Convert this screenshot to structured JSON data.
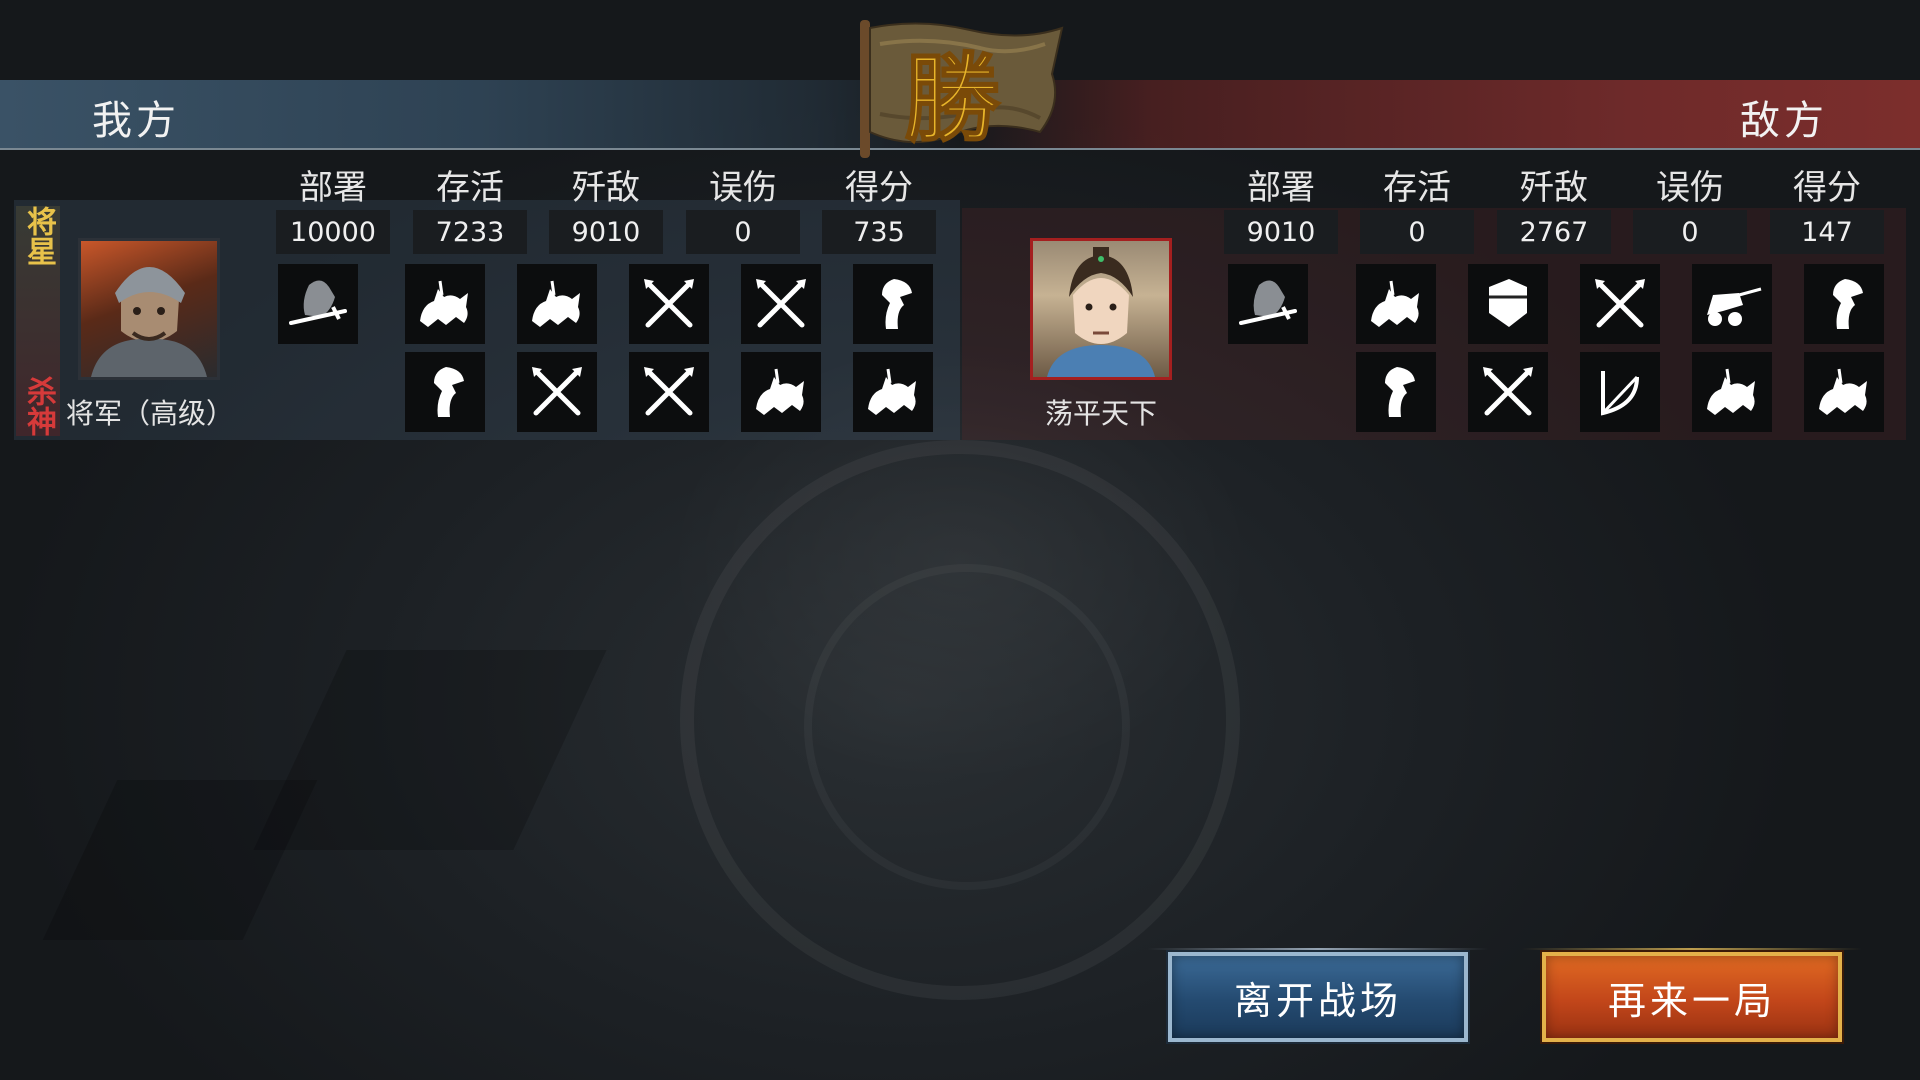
{
  "header": {
    "left_title": "我方",
    "right_title": "敌方",
    "result_text": "勝"
  },
  "columns": [
    "部署",
    "存活",
    "歼敌",
    "误伤",
    "得分"
  ],
  "player": {
    "rank_label": "将军（高级）",
    "badge_top": "将星",
    "badge_bottom": "杀神",
    "stats": [
      "10000",
      "7233",
      "9010",
      "0",
      "735"
    ],
    "units_row1": [
      "general-sword-icon",
      "cavalry-icon",
      "cavalry-icon",
      "crossed-spears-icon",
      "crossed-spears-icon",
      "axe-infantry-icon"
    ],
    "units_row2": [
      "axe-infantry-icon",
      "crossed-spears-icon",
      "crossed-spears-icon",
      "cavalry-icon",
      "cavalry-icon"
    ]
  },
  "enemy": {
    "name": "荡平天下",
    "stats": [
      "9010",
      "0",
      "2767",
      "0",
      "147"
    ],
    "units_row1": [
      "general-sword-icon",
      "cavalry-icon",
      "shield-icon",
      "crossed-spears-icon",
      "siege-cart-icon",
      "axe-infantry-icon"
    ],
    "units_row2": [
      "axe-infantry-icon",
      "crossed-spears-icon",
      "bow-icon",
      "cavalry-icon",
      "cavalry-icon"
    ]
  },
  "buttons": {
    "leave": "离开战场",
    "again": "再来一局"
  },
  "colors": {
    "ally_bar": "#3a5266",
    "enemy_bar": "#7c2e2c",
    "leave_button": "#244a70",
    "again_button": "#c2461a",
    "victory_gold": "#e8b52a"
  }
}
